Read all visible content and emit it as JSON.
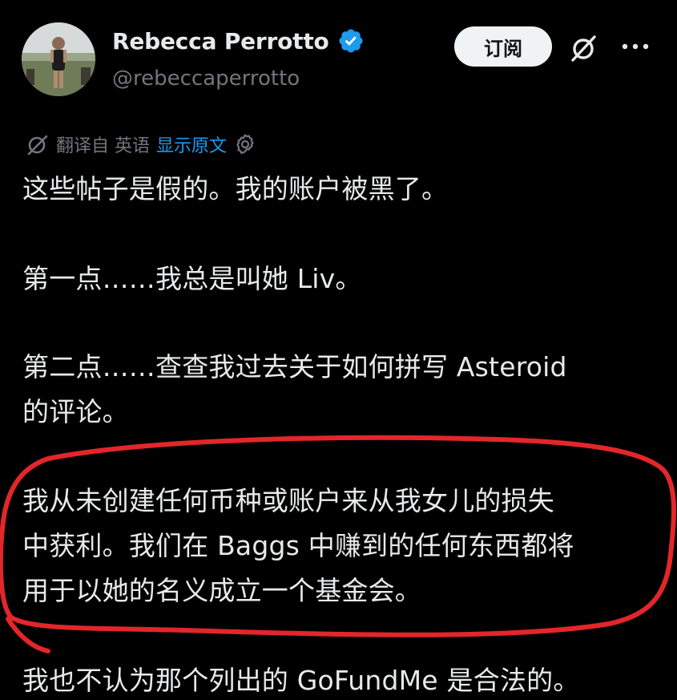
{
  "user": {
    "display_name": "Rebecca Perrotto",
    "handle": "@rebeccaperrotto",
    "verified": true
  },
  "actions": {
    "subscribe_label": "订阅",
    "grok_icon": "grok-icon",
    "more_icon": "more-icon"
  },
  "translation": {
    "translated_from": "翻译自 英语",
    "show_original": "显示原文"
  },
  "tweet": {
    "lines": [
      "这些帖子是假的。我的账户被黑了。",
      "第一点……我总是叫她 Liv。",
      "第二点……查查我过去关于如何拼写 Asteroid",
      "的评论。",
      "我从未创建任何币种或账户来从我女儿的损失",
      "中获利。我们在 Baggs 中赚到的任何东西都将",
      "用于以她的名义成立一个基金会。",
      "我也不认为那个列出的 GoFundMe 是合法的。"
    ]
  },
  "colors": {
    "background": "#000000",
    "text": "#e7e9ea",
    "muted": "#71767b",
    "link": "#1d9bf0",
    "verified": "#1d9bf0",
    "annotation": "#e3262a"
  }
}
